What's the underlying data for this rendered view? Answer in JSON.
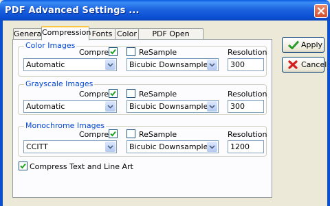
{
  "window": {
    "title": "PDF Advanced Settings ..."
  },
  "tabs": [
    {
      "label": "General"
    },
    {
      "label": "Compression"
    },
    {
      "label": "Fonts"
    },
    {
      "label": "Color"
    },
    {
      "label": "PDF Open Options"
    }
  ],
  "active_tab": "Compression",
  "groups": {
    "color": {
      "title": "Color Images",
      "compress_label": "Compress",
      "compress_checked": true,
      "resample_label": "ReSample",
      "resample_checked": false,
      "resolution_label": "Resolution",
      "method_value": "Automatic",
      "downsample_value": "Bicubic Downsample",
      "resolution_value": "300"
    },
    "grayscale": {
      "title": "Grayscale Images",
      "compress_label": "Compress",
      "compress_checked": true,
      "resample_label": "ReSample",
      "resample_checked": false,
      "resolution_label": "Resolution",
      "method_value": "Automatic",
      "downsample_value": "Bicubic Downsample",
      "resolution_value": "300"
    },
    "mono": {
      "title": "Monochrome Images",
      "compress_label": "Compress",
      "compress_checked": true,
      "resample_label": "ReSample",
      "resample_checked": false,
      "resolution_label": "Resolution",
      "method_value": "CCITT",
      "downsample_value": "Bicubic Downsample",
      "resolution_value": "1200"
    }
  },
  "compress_text": {
    "label": "Compress Text and Line Art",
    "checked": true
  },
  "buttons": {
    "apply": {
      "label": "Apply",
      "icon": "checkmark-icon"
    },
    "cancel": {
      "label": "Cancel",
      "icon": "red-x-icon"
    }
  },
  "colors": {
    "titlebar": "#0a5ae0",
    "group_title": "#0046d5",
    "tab_highlight": "#ffc73c",
    "dialog_bg": "#ece9d8"
  }
}
